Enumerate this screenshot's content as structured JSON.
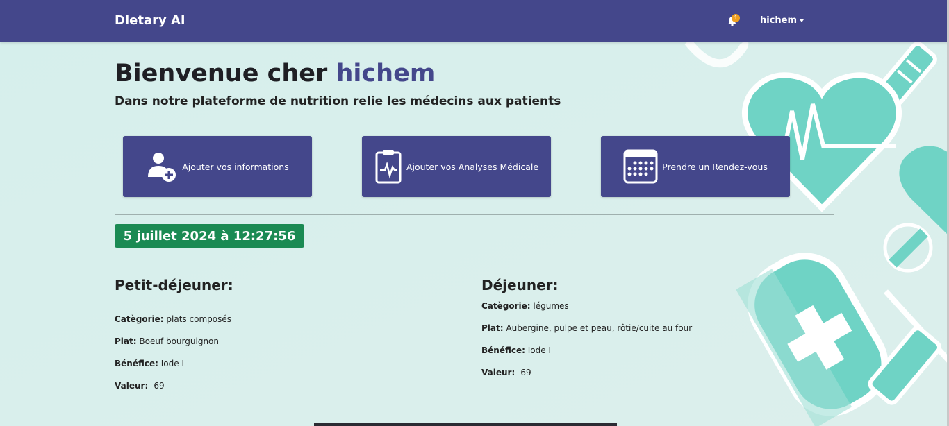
{
  "navbar": {
    "brand": "Dietary AI",
    "notification_count": "1",
    "username": "hichem"
  },
  "welcome": {
    "prefix": "Bienvenue cher",
    "name": "hichem",
    "subtitle": "Dans notre plateforme de nutrition relie les médecins aux patients"
  },
  "actions": [
    {
      "label": "Ajouter vos informations",
      "icon": "add-user-icon"
    },
    {
      "label": "Ajouter vos Analyses Médicale",
      "icon": "clipboard-pulse-icon"
    },
    {
      "label": "Prendre un Rendez-vous",
      "icon": "calendar-icon"
    }
  ],
  "datetime": "5 juillet 2024 à 12:27:56",
  "meals": {
    "breakfast": {
      "title": "Petit-déjeuner:",
      "category_label": "Catègorie:",
      "category": "plats composés",
      "dish_label": "Plat:",
      "dish": "Boeuf bourguignon",
      "benefit_label": "Bénéfice:",
      "benefit": "Iode I",
      "value_label": "Valeur:",
      "value": "-69"
    },
    "lunch": {
      "title": "Déjeuner:",
      "category_label": "Catègorie:",
      "category": "légumes",
      "dish_label": "Plat:",
      "dish": "Aubergine, pulpe et peau, rôtie/cuite au four",
      "benefit_label": "Bénéfice:",
      "benefit": "Iode I",
      "value_label": "Valeur:",
      "value": "-69"
    }
  },
  "colors": {
    "primary": "#44478b",
    "success": "#1a8a53",
    "background": "#d9eeeb",
    "decor_teal": "#6fd3c5"
  }
}
